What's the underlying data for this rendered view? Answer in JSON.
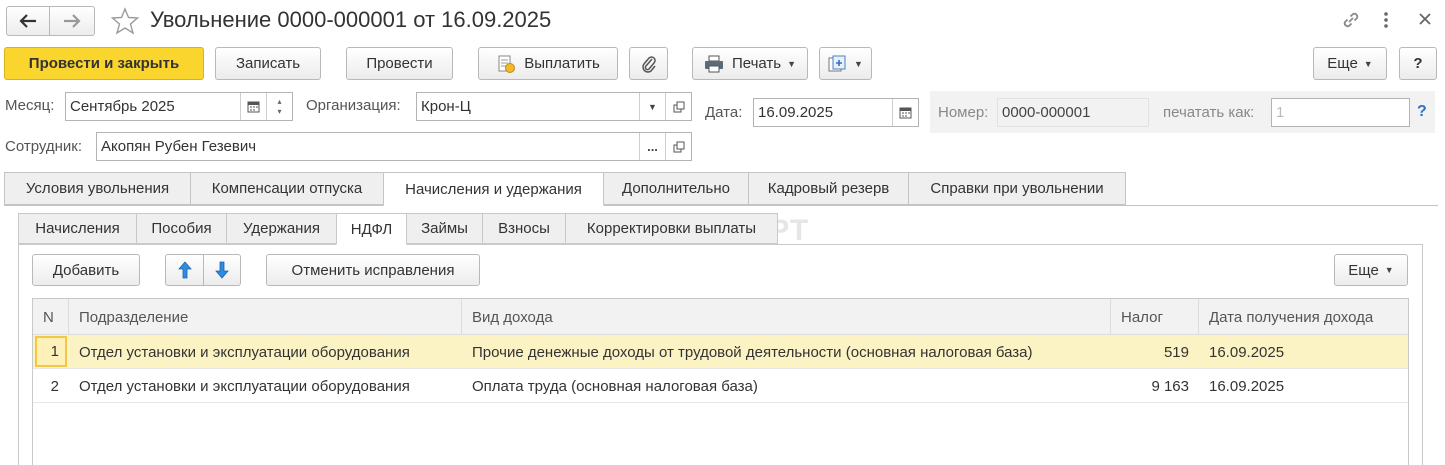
{
  "window": {
    "title": "Увольнение 0000-000001 от 16.09.2025",
    "back_icon": "arrow-left-icon",
    "forward_icon": "arrow-right-icon",
    "star_icon": "star-icon",
    "link_icon": "link-icon",
    "menu_icon": "more-vertical-icon",
    "close_icon": "close-icon"
  },
  "toolbar": {
    "post_close": "Провести и закрыть",
    "save": "Записать",
    "post": "Провести",
    "pay": "Выплатить",
    "print": "Печать",
    "more": "Еще",
    "help": "?"
  },
  "form": {
    "month_label": "Месяц:",
    "month_value": "Сентябрь 2025",
    "org_label": "Организация:",
    "org_value": "Крон-Ц",
    "date_label": "Дата:",
    "date_value": "16.09.2025",
    "number_label": "Номер:",
    "number_value": "0000-000001",
    "print_as_label": "печатать как:",
    "print_as_value": "1",
    "print_as_help": "?",
    "employee_label": "Сотрудник:",
    "employee_value": "Акопян Рубен Гезевич",
    "select_dots": "..."
  },
  "tabs": [
    "Условия увольнения",
    "Компенсации отпуска",
    "Начисления и удержания",
    "Дополнительно",
    "Кадровый резерв",
    "Справки при увольнении"
  ],
  "subtabs": [
    "Начисления",
    "Пособия",
    "Удержания",
    "НДФЛ",
    "Займы",
    "Взносы",
    "Корректировки выплаты"
  ],
  "watermark": "БУХЭКСПЕРТ",
  "table_toolbar": {
    "add": "Добавить",
    "cancel_fix": "Отменить исправления",
    "more": "Еще"
  },
  "table": {
    "columns": [
      "N",
      "Подразделение",
      "Вид дохода",
      "Налог",
      "Дата получения дохода"
    ],
    "rows": [
      {
        "n": "1",
        "dept": "Отдел установки и эксплуатации оборудования",
        "income": "Прочие денежные доходы от трудовой деятельности (основная налоговая база)",
        "tax": "519",
        "date": "16.09.2025"
      },
      {
        "n": "2",
        "dept": "Отдел установки и эксплуатации оборудования",
        "income": "Оплата труда (основная налоговая база)",
        "tax": "9 163",
        "date": "16.09.2025"
      }
    ]
  },
  "colors": {
    "primary_button": "#f9d52e",
    "selected_row": "#fcf3c4",
    "help_blue": "#2f72c4"
  }
}
